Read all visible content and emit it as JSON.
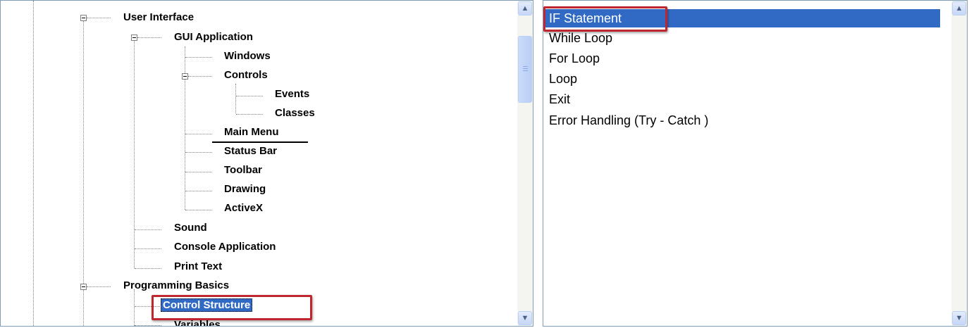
{
  "tree": {
    "items": [
      {
        "label": "User Interface"
      },
      {
        "label": "GUI Application"
      },
      {
        "label": "Windows"
      },
      {
        "label": "Controls"
      },
      {
        "label": "Events"
      },
      {
        "label": "Classes"
      },
      {
        "label": "Main Menu"
      },
      {
        "label": "Status Bar"
      },
      {
        "label": "Toolbar"
      },
      {
        "label": "Drawing"
      },
      {
        "label": "ActiveX"
      },
      {
        "label": "Sound"
      },
      {
        "label": "Console Application"
      },
      {
        "label": "Print Text"
      },
      {
        "label": "Programming Basics"
      },
      {
        "label": "Control Structure"
      },
      {
        "label": "Variables"
      }
    ],
    "selected": "Control Structure"
  },
  "list": {
    "items": [
      {
        "label": "IF Statement"
      },
      {
        "label": "While Loop"
      },
      {
        "label": "For Loop"
      },
      {
        "label": "Loop"
      },
      {
        "label": "Exit"
      },
      {
        "label": "Error Handling (Try - Catch )"
      }
    ],
    "selected": "IF Statement"
  },
  "icons": {
    "scroll_up": "scroll-up-arrow-icon",
    "scroll_down": "scroll-down-arrow-icon",
    "collapse": "collapse-minus-icon"
  },
  "colors": {
    "selection": "#316ac5",
    "highlight_box": "#c0262d",
    "border": "#7f9db9"
  }
}
